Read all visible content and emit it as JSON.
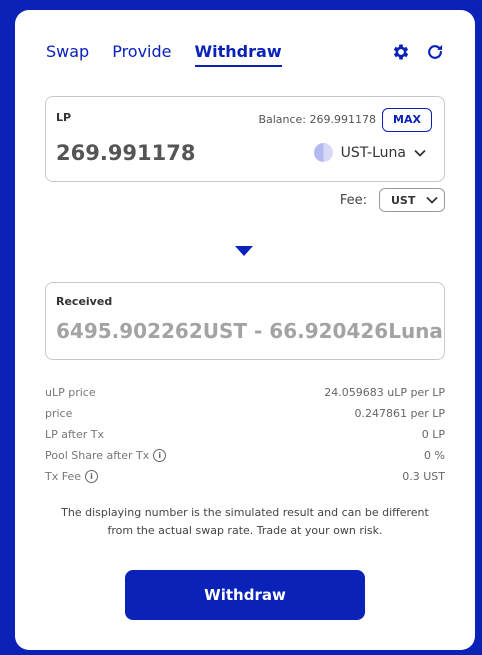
{
  "tabs": [
    {
      "label": "Swap"
    },
    {
      "label": "Provide"
    },
    {
      "label": "Withdraw"
    }
  ],
  "icons": {
    "settings": "gear-icon",
    "refresh": "refresh-icon"
  },
  "lp_box": {
    "label": "LP",
    "balance_label": "Balance: 269.991178",
    "max_label": "MAX",
    "value": "269.991178",
    "token": "UST-Luna"
  },
  "fee": {
    "label": "Fee:",
    "selected": "UST"
  },
  "received": {
    "label": "Received",
    "value": "6495.902262UST - 66.920426Luna"
  },
  "stats": [
    {
      "label": "uLP price",
      "value": "24.059683 uLP per LP"
    },
    {
      "label": "price",
      "value": "0.247861 per LP"
    },
    {
      "label": "LP after Tx",
      "value": "0 LP"
    },
    {
      "label": "Pool Share after Tx",
      "value": "0 %"
    },
    {
      "label": "Tx Fee",
      "value": "0.3 UST"
    }
  ],
  "disclaimer": "The displaying number is the simulated result and can be different from the actual swap rate. Trade at your own risk.",
  "withdraw_button": "Withdraw",
  "colors": {
    "brand": "#0a22b8",
    "background": "#ffffff"
  }
}
